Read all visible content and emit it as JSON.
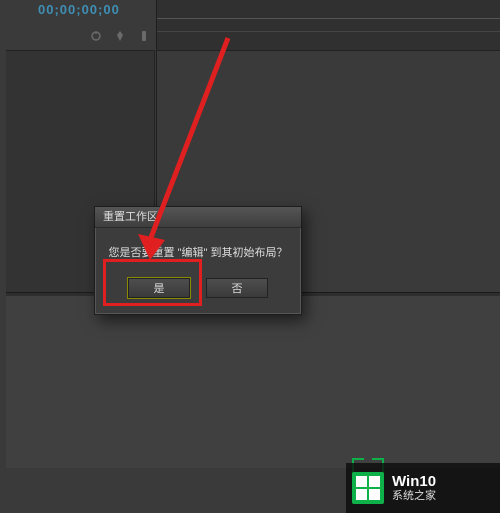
{
  "editor": {
    "timecode": "00;00;00;00"
  },
  "dialog": {
    "title": "重置工作区",
    "message": "您是否要重置 \"编辑\" 到其初始布局？",
    "yes_label": "是",
    "no_label": "否"
  },
  "watermark": {
    "line1": "Win10",
    "line2": "系统之家"
  },
  "colors": {
    "accent_red": "#e02020",
    "accent_green": "#0eb04a",
    "timecode": "#3f8fb5"
  }
}
